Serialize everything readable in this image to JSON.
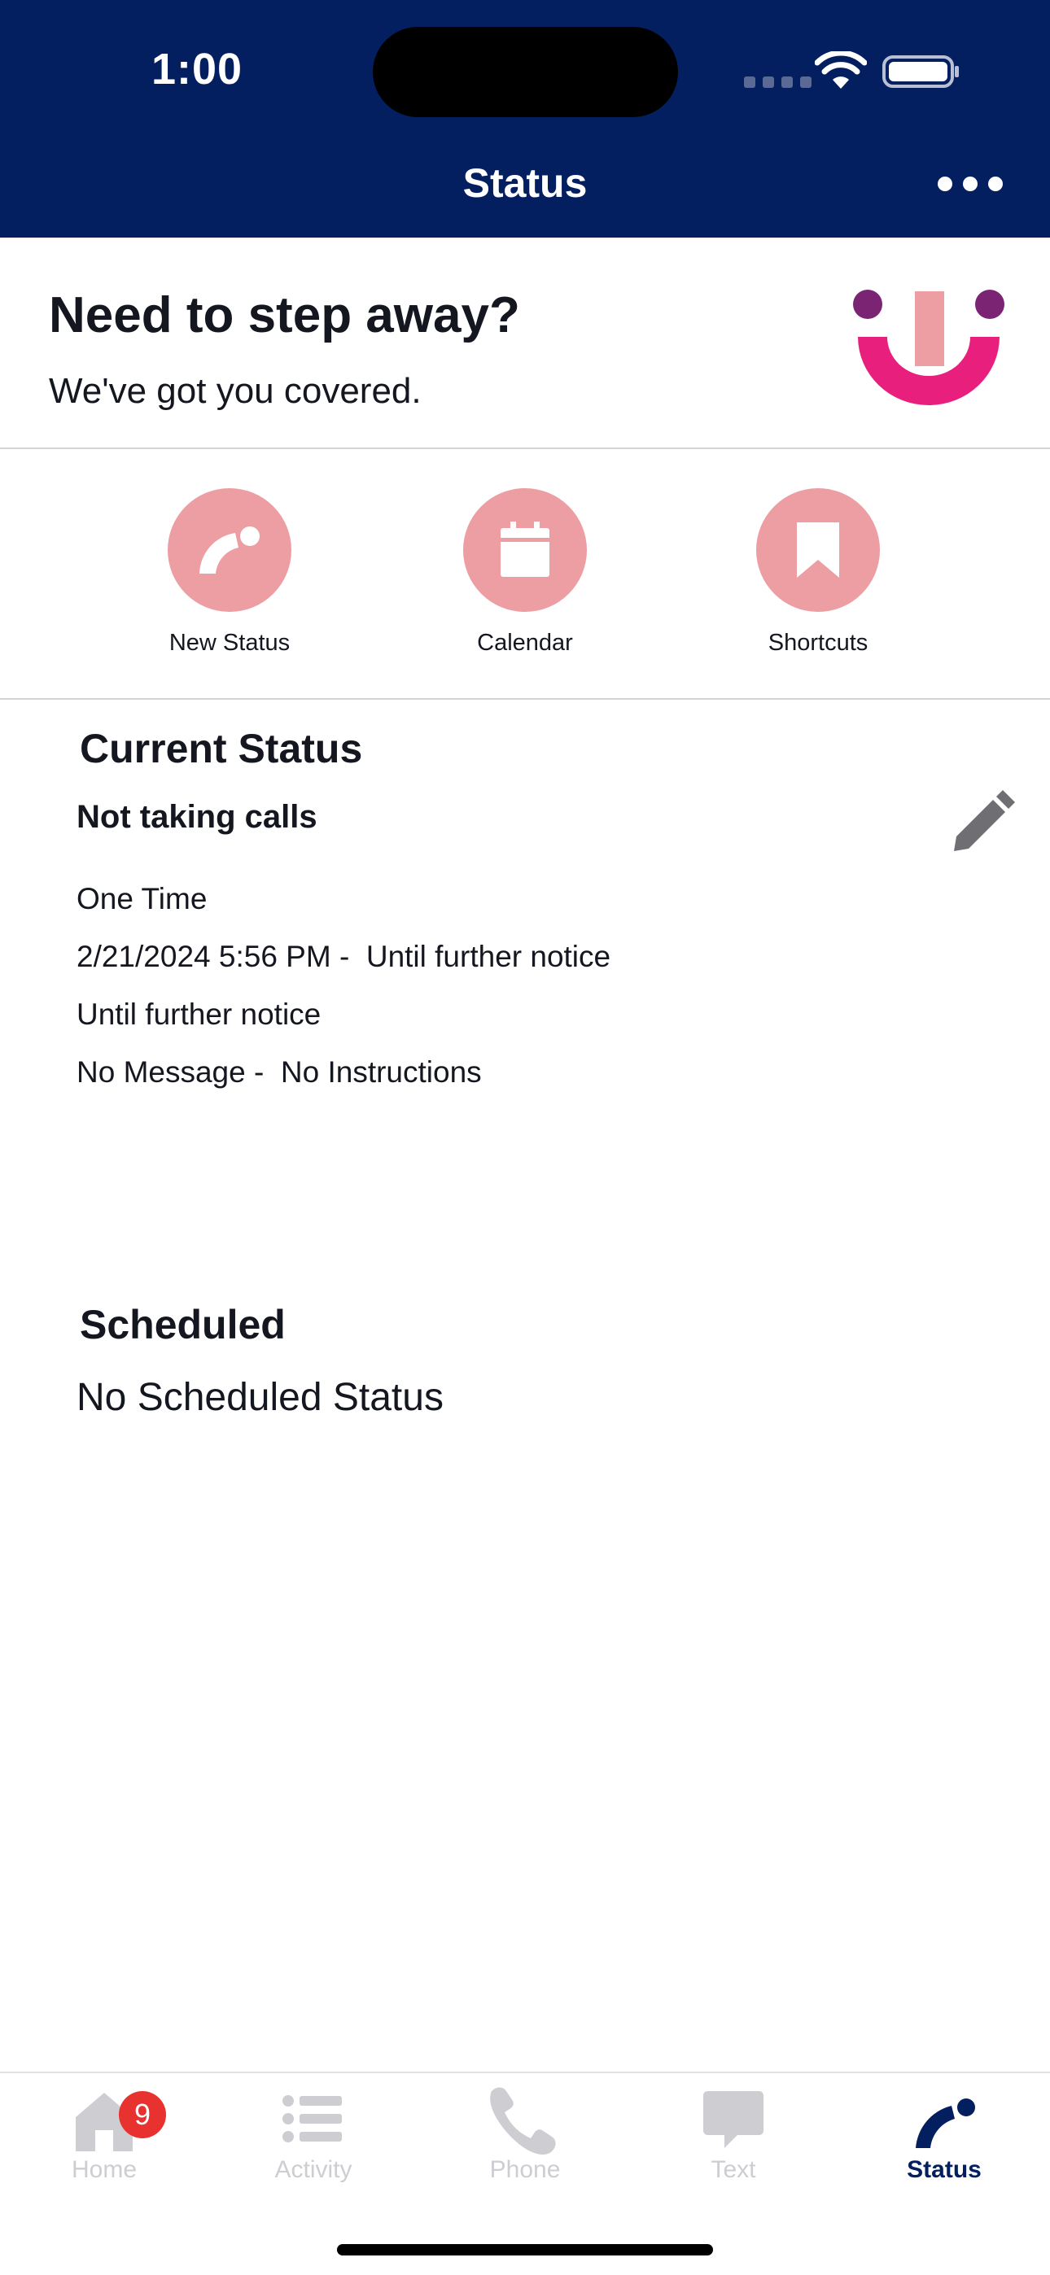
{
  "status_bar": {
    "time": "1:00"
  },
  "nav": {
    "title": "Status"
  },
  "hero": {
    "title": "Need to step away?",
    "subtitle": "We've got you covered."
  },
  "actions": [
    {
      "label": "New Status",
      "icon": "new-status-icon"
    },
    {
      "label": "Calendar",
      "icon": "calendar-icon"
    },
    {
      "label": "Shortcuts",
      "icon": "bookmark-icon"
    }
  ],
  "current_status": {
    "heading": "Current Status",
    "name": "Not taking calls",
    "frequency": "One Time",
    "start": "2/21/2024 5:56 PM",
    "start_separator": " -  ",
    "end": "Until further notice",
    "duration": "Until further notice",
    "message": "No Message",
    "message_separator": " -  ",
    "instructions": "No Instructions"
  },
  "scheduled": {
    "heading": "Scheduled",
    "empty_text": "No Scheduled Status"
  },
  "tabbar": {
    "active": "Status",
    "tabs": [
      {
        "label": "Home",
        "icon": "home-icon",
        "badge": "9"
      },
      {
        "label": "Activity",
        "icon": "list-icon"
      },
      {
        "label": "Phone",
        "icon": "phone-icon"
      },
      {
        "label": "Text",
        "icon": "chat-bubble-icon"
      },
      {
        "label": "Status",
        "icon": "status-icon"
      }
    ]
  },
  "colors": {
    "header_bg": "#031f60",
    "action_circle": "#ec9ea3",
    "heading_highlight": "#faeacb",
    "badge": "#e8322f",
    "tab_inactive": "#cdcdd2",
    "tab_active": "#031f60"
  }
}
